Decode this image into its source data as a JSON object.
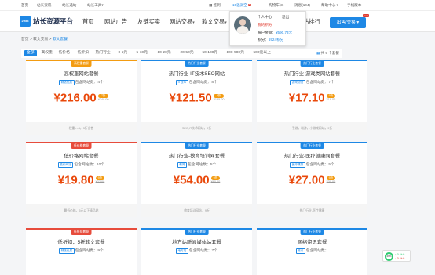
{
  "topbar": {
    "links": [
      "首页",
      "站长资讯",
      "站长选站",
      "站长工具▾"
    ],
    "right": {
      "sign": "签到",
      "user": "15温渊空",
      "user_badge": "6",
      "cart": "购物车(3)",
      "msg": "消息(104)",
      "help": "帮助中心 ▾",
      "mobile": "手机版本"
    }
  },
  "logo": {
    "box": "2958",
    "name": "站长资源平台"
  },
  "nav": {
    "items": [
      "首页",
      "网站广告",
      "友链买卖",
      "网站交易",
      "软文交易"
    ],
    "rank": "站排行",
    "publish": "出售/交换 ▾",
    "publish_new": "new"
  },
  "breadcrumb": {
    "home": "首页",
    "sep": ">",
    "level1": "软文交易",
    "current": "软文套餐"
  },
  "filter": {
    "chips": [
      "全部",
      "高权重",
      "低价格",
      "低折扣",
      "热门行业",
      "0-5元",
      "5-10元",
      "10-20元",
      "20-50元",
      "50-100元",
      "100-500元",
      "500元以上"
    ],
    "right": "共 9 个套餐"
  },
  "cards": [
    {
      "tag": "高权重套餐",
      "tag_color": "#f39c12",
      "title": "高权重网站套餐",
      "meta_tag": "精选优质",
      "meta": "包含网站数：4个",
      "price": "¥216.00",
      "disc": "7折",
      "orig": "¥240.00",
      "foot": "权重>=4，3折出售"
    },
    {
      "tag": "热门行业套餐",
      "tag_color": "#1e88e5",
      "title": "热门行业-IT技术SEO网站",
      "meta_tag": "IT技术",
      "meta": "包含网站数：8个",
      "price": "¥121.50",
      "disc": "9折",
      "orig": "¥135.00",
      "foot": "SEO,IT技术网站，9折"
    },
    {
      "tag": "热门行业套餐",
      "tag_color": "#1e88e5",
      "title": "热门行业-游戏类网站套餐",
      "meta_tag": "游戏动漫",
      "meta": "包含网站数：7个",
      "price": "¥17.10",
      "disc": "9折",
      "orig": "¥19.00",
      "foot": "手游，端游，小游戏网站，9折"
    },
    {
      "tag": "低价格套餐",
      "tag_color": "#e74c3c",
      "title": "低价格网站套餐",
      "meta_tag": "低价网站",
      "meta": "包含网站数：10个",
      "price": "¥19.80",
      "disc": "9折",
      "orig": "¥22.00",
      "foot": "最低价格，5元以下精品站"
    },
    {
      "tag": "热门行业套餐",
      "tag_color": "#1e88e5",
      "title": "热门行业-教育培训网套餐",
      "meta_tag": "教育",
      "meta": "包含网站数：5个",
      "price": "¥54.00",
      "disc": "9折",
      "orig": "¥60.00",
      "foot": "教育培训网站，9折"
    },
    {
      "tag": "热门行业套餐",
      "tag_color": "#1e88e5",
      "title": "热门行业-医疗健康网套餐",
      "meta_tag": "医疗健康",
      "meta": "包含网站数：5个",
      "price": "¥27.00",
      "disc": "9折",
      "orig": "¥30.00",
      "foot": "热门行业-医疗健康"
    },
    {
      "tag": "低折扣套餐",
      "tag_color": "#e74c3c",
      "title": "低折扣，5折软文套餐",
      "meta_tag": "精选优质",
      "meta": "包含网站数：9个",
      "price": "",
      "disc": "",
      "orig": "",
      "foot": ""
    },
    {
      "tag": "热门行业套餐",
      "tag_color": "#1e88e5",
      "title": "地方站新闻媒体站套餐",
      "meta_tag": "地方站",
      "meta": "包含网站数：7个",
      "price": "",
      "disc": "",
      "orig": "",
      "foot": ""
    },
    {
      "tag": "热门行业套餐",
      "tag_color": "#1e88e5",
      "title": "网络资讯套餐",
      "meta_tag": "资讯",
      "meta": "包含网站数：",
      "price": "",
      "disc": "",
      "orig": "",
      "foot": ""
    }
  ],
  "popup": {
    "center": "个人中心",
    "logout": "退出",
    "points": "我的积分",
    "balance_label": "账户金额：",
    "balance": "¥590.73元",
    "id_label": "积分：",
    "id_value": "6924积分"
  },
  "float_widget": {
    "pct": "29%",
    "up": "↑ 0.6k/s",
    "down": "↓ 0.6k/s"
  }
}
